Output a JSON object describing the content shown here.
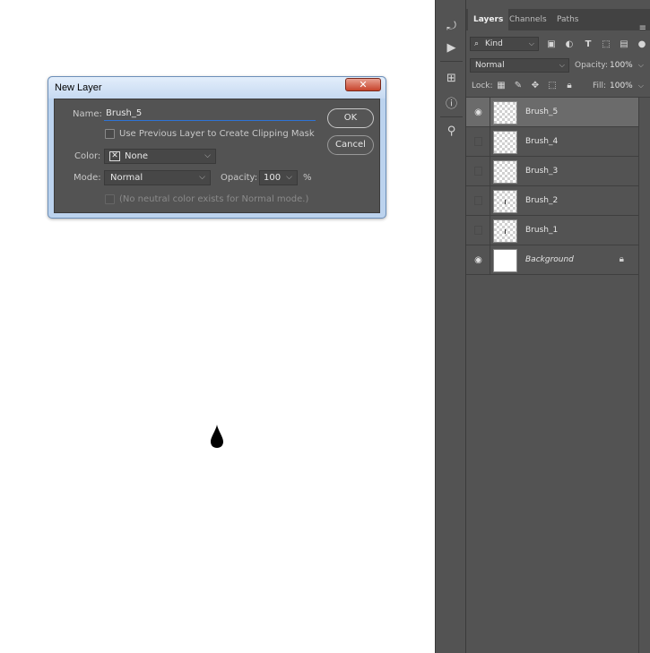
{
  "dialog": {
    "title": "New Layer",
    "close_label": "✕",
    "name_label": "Name:",
    "name_value": "Brush_5",
    "clipping_label": "Use Previous Layer to Create Clipping Mask",
    "color_label": "Color:",
    "color_value": "None",
    "mode_label": "Mode:",
    "mode_value": "Normal",
    "opacity_label": "Opacity:",
    "opacity_value": "100",
    "opacity_unit": "%",
    "neutral_label": "(No neutral color exists for Normal mode.)",
    "ok_label": "OK",
    "cancel_label": "Cancel"
  },
  "panel": {
    "collapse_left": "◂◂",
    "collapse_right": "▸▸",
    "tabs": [
      {
        "label": "Layers",
        "active": true
      },
      {
        "label": "Channels",
        "active": false
      },
      {
        "label": "Paths",
        "active": false
      }
    ],
    "filter_label": "Kind",
    "blend_mode": "Normal",
    "opacity_label": "Opacity:",
    "opacity_value": "100%",
    "lock_label": "Lock:",
    "fill_label": "Fill:",
    "fill_value": "100%",
    "layers": [
      {
        "name": "Brush_5",
        "visible": true,
        "selected": true,
        "thumb": "transparent"
      },
      {
        "name": "Brush_4",
        "visible": false,
        "selected": false,
        "thumb": "transparent"
      },
      {
        "name": "Brush_3",
        "visible": false,
        "selected": false,
        "thumb": "transparent"
      },
      {
        "name": "Brush_2",
        "visible": false,
        "selected": false,
        "thumb": "mark"
      },
      {
        "name": "Brush_1",
        "visible": false,
        "selected": false,
        "thumb": "mark"
      },
      {
        "name": "Background",
        "visible": true,
        "selected": false,
        "thumb": "white",
        "locked": true
      }
    ]
  },
  "colors": {
    "panel_bg": "#535353",
    "selected_row": "#6b6b6b",
    "accent_underline": "#2d73d6"
  }
}
